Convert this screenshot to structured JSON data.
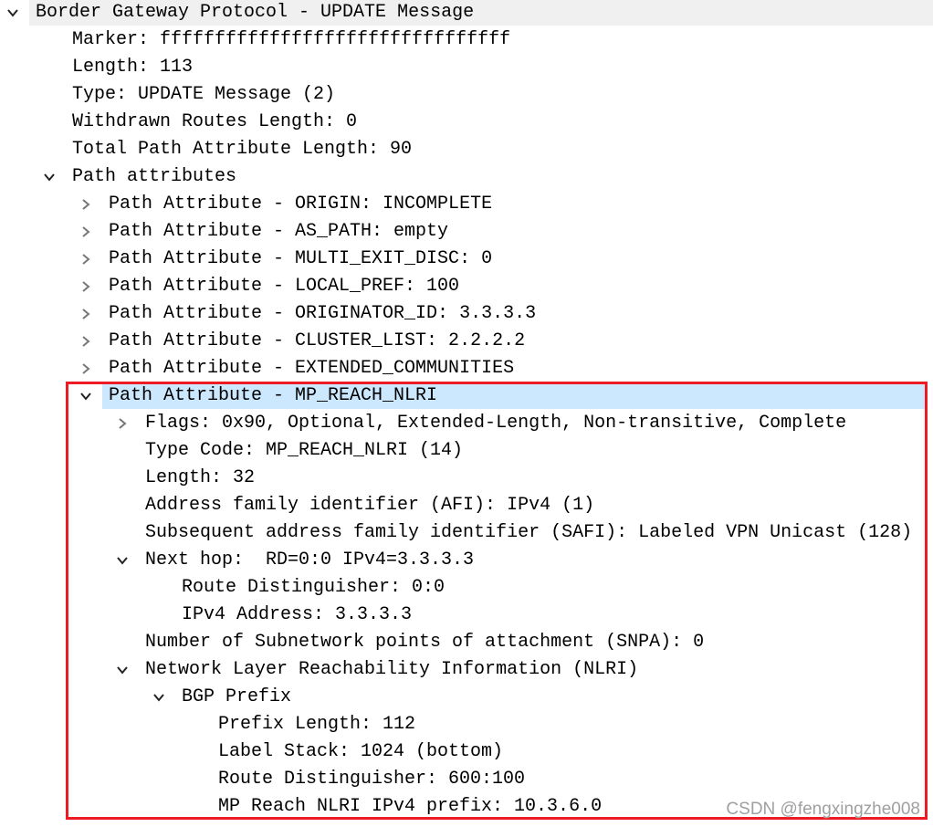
{
  "colors": {
    "selected_row": "#cce8ff",
    "top_row": "#f0f0f0",
    "highlight_box": "#ed1c24"
  },
  "rows": [
    {
      "text": "Border Gateway Protocol - UPDATE Message",
      "level": 0,
      "expander": "expanded",
      "style": "top"
    },
    {
      "text": "Marker: ffffffffffffffffffffffffffffffff",
      "level": 1,
      "expander": "none"
    },
    {
      "text": "Length: 113",
      "level": 1,
      "expander": "none"
    },
    {
      "text": "Type: UPDATE Message (2)",
      "level": 1,
      "expander": "none"
    },
    {
      "text": "Withdrawn Routes Length: 0",
      "level": 1,
      "expander": "none"
    },
    {
      "text": "Total Path Attribute Length: 90",
      "level": 1,
      "expander": "none"
    },
    {
      "text": "Path attributes",
      "level": 1,
      "expander": "expanded"
    },
    {
      "text": "Path Attribute - ORIGIN: INCOMPLETE",
      "level": 2,
      "expander": "collapsed"
    },
    {
      "text": "Path Attribute - AS_PATH: empty",
      "level": 2,
      "expander": "collapsed"
    },
    {
      "text": "Path Attribute - MULTI_EXIT_DISC: 0",
      "level": 2,
      "expander": "collapsed"
    },
    {
      "text": "Path Attribute - LOCAL_PREF: 100",
      "level": 2,
      "expander": "collapsed"
    },
    {
      "text": "Path Attribute - ORIGINATOR_ID: 3.3.3.3",
      "level": 2,
      "expander": "collapsed"
    },
    {
      "text": "Path Attribute - CLUSTER_LIST: 2.2.2.2",
      "level": 2,
      "expander": "collapsed"
    },
    {
      "text": "Path Attribute - EXTENDED_COMMUNITIES",
      "level": 2,
      "expander": "collapsed"
    },
    {
      "text": "Path Attribute - MP_REACH_NLRI",
      "level": 2,
      "expander": "expanded",
      "style": "sel"
    },
    {
      "text": "Flags: 0x90, Optional, Extended-Length, Non-transitive, Complete",
      "level": 3,
      "expander": "collapsed"
    },
    {
      "text": "Type Code: MP_REACH_NLRI (14)",
      "level": 3,
      "expander": "none"
    },
    {
      "text": "Length: 32",
      "level": 3,
      "expander": "none"
    },
    {
      "text": "Address family identifier (AFI): IPv4 (1)",
      "level": 3,
      "expander": "none"
    },
    {
      "text": "Subsequent address family identifier (SAFI): Labeled VPN Unicast (128)",
      "level": 3,
      "expander": "none"
    },
    {
      "text": "Next hop:  RD=0:0 IPv4=3.3.3.3",
      "level": 3,
      "expander": "expanded"
    },
    {
      "text": "Route Distinguisher: 0:0",
      "level": 4,
      "expander": "none"
    },
    {
      "text": "IPv4 Address: 3.3.3.3",
      "level": 4,
      "expander": "none"
    },
    {
      "text": "Number of Subnetwork points of attachment (SNPA): 0",
      "level": 3,
      "expander": "none"
    },
    {
      "text": "Network Layer Reachability Information (NLRI)",
      "level": 3,
      "expander": "expanded"
    },
    {
      "text": "BGP Prefix",
      "level": 4,
      "expander": "expanded"
    },
    {
      "text": "Prefix Length: 112",
      "level": 5,
      "expander": "none"
    },
    {
      "text": "Label Stack: 1024 (bottom)",
      "level": 5,
      "expander": "none"
    },
    {
      "text": "Route Distinguisher: 600:100",
      "level": 5,
      "expander": "none"
    },
    {
      "text": "MP Reach NLRI IPv4 prefix: 10.3.6.0",
      "level": 5,
      "expander": "none"
    }
  ],
  "watermark": "CSDN @fengxingzhe008"
}
